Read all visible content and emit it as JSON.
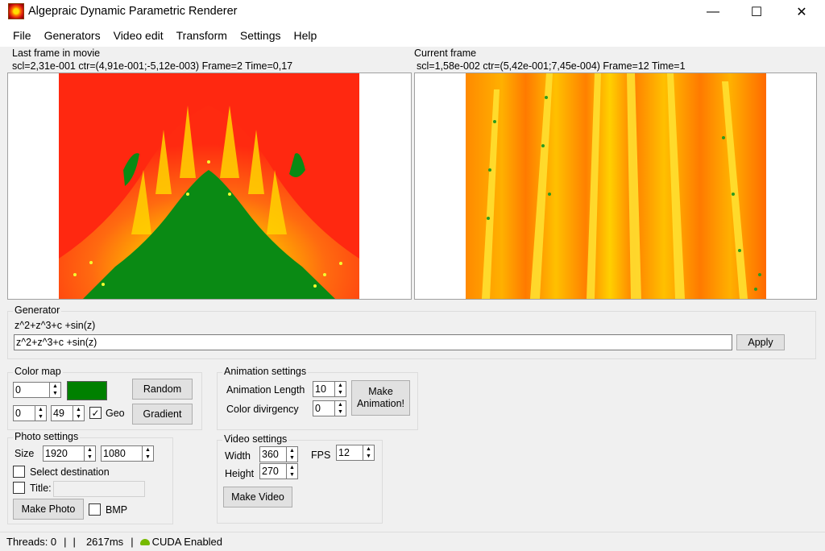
{
  "app": {
    "title": "Algepraic Dynamic Parametric Renderer",
    "icon": "fractal-app-icon"
  },
  "window_controls": {
    "minimize": "—",
    "maximize": "☐",
    "close": "✕"
  },
  "menu": [
    "File",
    "Generators",
    "Video edit",
    "Transform",
    "Settings",
    "Help"
  ],
  "left_frame": {
    "title": "Last frame in movie",
    "info": "scl=2,31e-001 ctr=(4,91e-001;-5,12e-003) Frame=2 Time=0,17"
  },
  "right_frame": {
    "title": "Current frame",
    "info": "scl=1,58e-002 ctr=(5,42e-001;7,45e-004) Frame=12 Time=1"
  },
  "generator": {
    "group_title": "Generator",
    "current": "z^2+z^3+c +sin(z)",
    "input_value": "z^2+z^3+c +sin(z)",
    "apply_label": "Apply"
  },
  "color_map": {
    "group_title": "Color map",
    "index_value": "0",
    "swatch_color": "#008000",
    "random_label": "Random",
    "start_value": "0",
    "end_value": "49",
    "geo_checked": true,
    "geo_label": "Geo",
    "gradient_label": "Gradient"
  },
  "animation_settings": {
    "group_title": "Animation settings",
    "length_label": "Animation Length",
    "length_value": "10",
    "divergency_label": "Color divirgency",
    "divergency_value": "0",
    "make_label": "Make Animation!"
  },
  "photo_settings": {
    "group_title": "Photo settings",
    "size_label": "Size",
    "width_value": "1920",
    "height_value": "1080",
    "select_destination_label": "Select destination",
    "select_destination_checked": false,
    "title_label": "Title:",
    "title_checked": false,
    "title_value": "",
    "make_photo_label": "Make Photo",
    "bmp_label": "BMP",
    "bmp_checked": false
  },
  "video_settings": {
    "group_title": "Video settings",
    "width_label": "Width",
    "width_value": "360",
    "height_label": "Height",
    "height_value": "270",
    "fps_label": "FPS",
    "fps_value": "12",
    "make_video_label": "Make Video"
  },
  "status": {
    "threads": "Threads: 0",
    "sep1": "|",
    "sep2": "|",
    "time": "2617ms",
    "sep3": "|",
    "cuda": "CUDA Enabled",
    "cuda_icon": "nvidia-icon"
  }
}
